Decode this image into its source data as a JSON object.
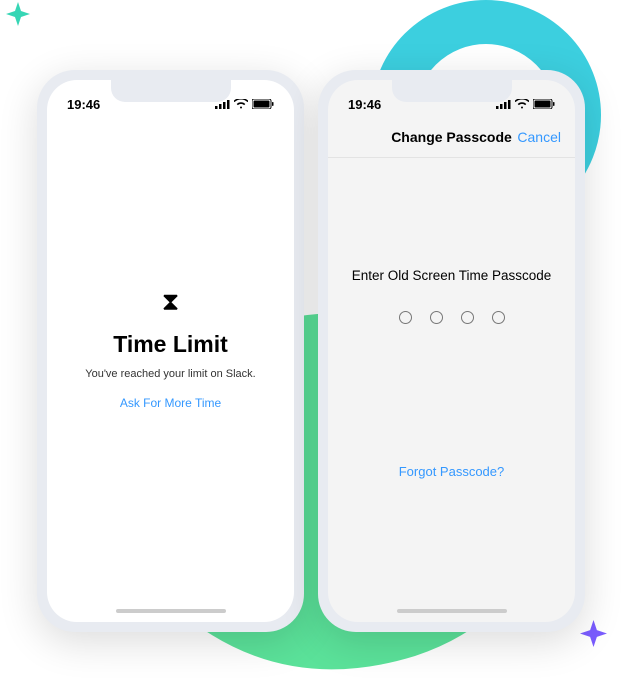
{
  "statusbar": {
    "time": "19:46"
  },
  "phone1": {
    "title": "Time Limit",
    "subtitle": "You've reached your limit on Slack.",
    "link": "Ask For More Time"
  },
  "phone2": {
    "navTitle": "Change Passcode",
    "navCancel": "Cancel",
    "prompt": "Enter Old Screen Time Passcode",
    "forgot": "Forgot Passcode?"
  }
}
